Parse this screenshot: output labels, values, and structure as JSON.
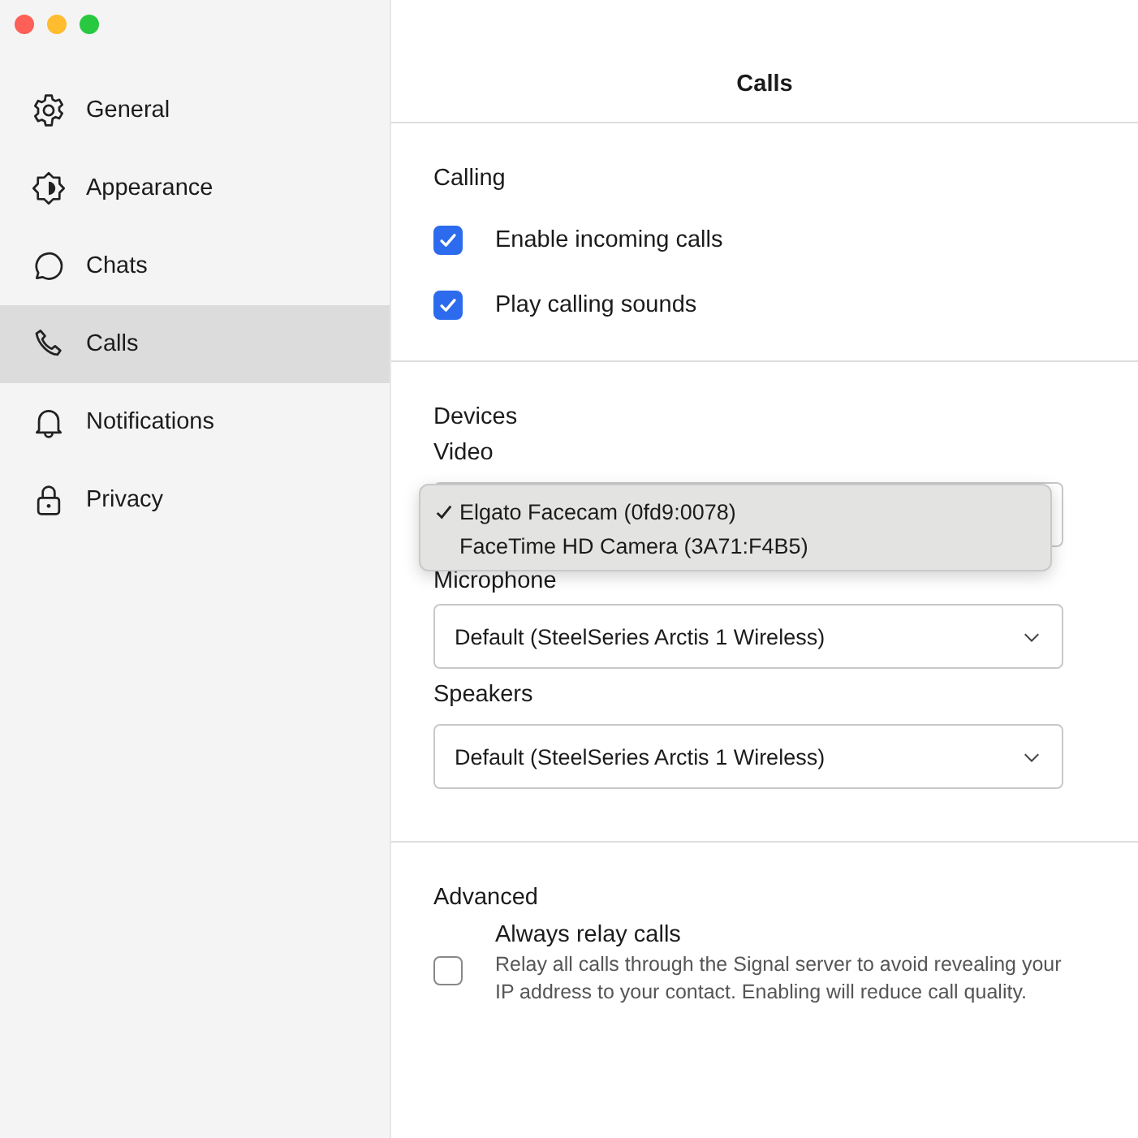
{
  "sidebar": {
    "items": [
      {
        "label": "General",
        "selected": false
      },
      {
        "label": "Appearance",
        "selected": false
      },
      {
        "label": "Chats",
        "selected": false
      },
      {
        "label": "Calls",
        "selected": true
      },
      {
        "label": "Notifications",
        "selected": false
      },
      {
        "label": "Privacy",
        "selected": false
      }
    ]
  },
  "page": {
    "title": "Calls",
    "calling": {
      "heading": "Calling",
      "options": [
        {
          "label": "Enable incoming calls",
          "checked": true
        },
        {
          "label": "Play calling sounds",
          "checked": true
        }
      ]
    },
    "devices": {
      "heading": "Devices",
      "video": {
        "label": "Video",
        "menu": [
          {
            "label": "Elgato Facecam (0fd9:0078)",
            "selected": true
          },
          {
            "label": "FaceTime HD Camera (3A71:F4B5)",
            "selected": false
          }
        ]
      },
      "microphone": {
        "label": "Microphone",
        "value": "Default (SteelSeries Arctis 1 Wireless)"
      },
      "speakers": {
        "label": "Speakers",
        "value": "Default (SteelSeries Arctis 1 Wireless)"
      }
    },
    "advanced": {
      "heading": "Advanced",
      "option": {
        "label": "Always relay calls",
        "description": "Relay all calls through the Signal server to avoid revealing your IP address to your contact. Enabling will reduce call quality.",
        "checked": false
      }
    }
  }
}
